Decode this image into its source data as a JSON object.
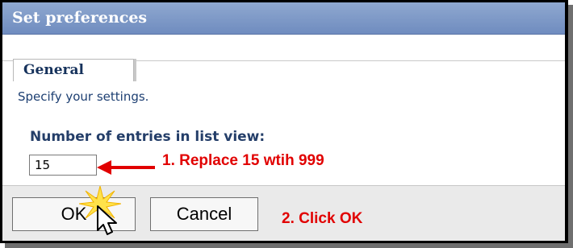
{
  "dialog": {
    "title": "Set preferences",
    "tabs": [
      {
        "label": "General",
        "selected": true
      }
    ],
    "description": "Specify your settings.",
    "entries_label": "Number of entries in list view:",
    "entries_value": "15"
  },
  "buttons": {
    "ok_label": "OK",
    "cancel_label": "Cancel"
  },
  "annotations": {
    "step1": "1.  Replace 15 wtih 999",
    "step2": "2.  Click OK",
    "color": "#e10000"
  },
  "colors": {
    "titlebar": "#7f9ac8",
    "label_text": "#243e69",
    "bottombar": "#eaeaea"
  },
  "icons": [
    "red-arrow-icon",
    "click-burst-icon",
    "mouse-pointer-icon"
  ]
}
